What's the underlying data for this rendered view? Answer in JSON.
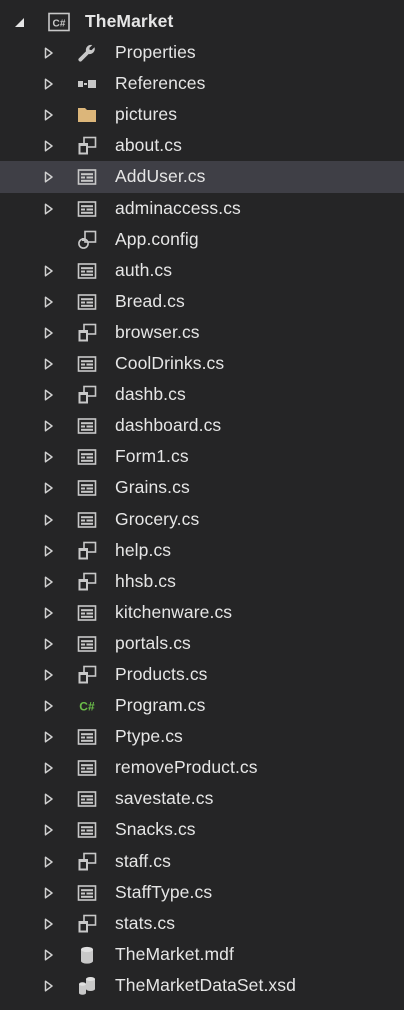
{
  "project": {
    "name": "TheMarket",
    "icon": "csharp-project-icon",
    "expanded": true
  },
  "items": [
    {
      "label": "Properties",
      "icon": "wrench-icon",
      "expandable": true
    },
    {
      "label": "References",
      "icon": "references-icon",
      "expandable": true
    },
    {
      "label": "pictures",
      "icon": "folder-icon",
      "expandable": true
    },
    {
      "label": "about.cs",
      "icon": "form-icon",
      "expandable": true
    },
    {
      "label": "AddUser.cs",
      "icon": "usercontrol-icon",
      "expandable": true,
      "selected": true
    },
    {
      "label": "adminaccess.cs",
      "icon": "usercontrol-icon",
      "expandable": true
    },
    {
      "label": "App.config",
      "icon": "config-icon",
      "expandable": false
    },
    {
      "label": "auth.cs",
      "icon": "usercontrol-icon",
      "expandable": true
    },
    {
      "label": "Bread.cs",
      "icon": "usercontrol-icon",
      "expandable": true
    },
    {
      "label": "browser.cs",
      "icon": "form-icon",
      "expandable": true
    },
    {
      "label": "CoolDrinks.cs",
      "icon": "usercontrol-icon",
      "expandable": true
    },
    {
      "label": "dashb.cs",
      "icon": "form-icon",
      "expandable": true
    },
    {
      "label": "dashboard.cs",
      "icon": "usercontrol-icon",
      "expandable": true
    },
    {
      "label": "Form1.cs",
      "icon": "usercontrol-icon",
      "expandable": true
    },
    {
      "label": "Grains.cs",
      "icon": "usercontrol-icon",
      "expandable": true
    },
    {
      "label": "Grocery.cs",
      "icon": "usercontrol-icon",
      "expandable": true
    },
    {
      "label": "help.cs",
      "icon": "form-icon",
      "expandable": true
    },
    {
      "label": "hhsb.cs",
      "icon": "form-icon",
      "expandable": true
    },
    {
      "label": "kitchenware.cs",
      "icon": "usercontrol-icon",
      "expandable": true
    },
    {
      "label": "portals.cs",
      "icon": "usercontrol-icon",
      "expandable": true
    },
    {
      "label": "Products.cs",
      "icon": "form-icon",
      "expandable": true
    },
    {
      "label": "Program.cs",
      "icon": "csharp-file-icon",
      "expandable": true
    },
    {
      "label": "Ptype.cs",
      "icon": "usercontrol-icon",
      "expandable": true
    },
    {
      "label": "removeProduct.cs",
      "icon": "usercontrol-icon",
      "expandable": true
    },
    {
      "label": "savestate.cs",
      "icon": "usercontrol-icon",
      "expandable": true
    },
    {
      "label": "Snacks.cs",
      "icon": "usercontrol-icon",
      "expandable": true
    },
    {
      "label": "staff.cs",
      "icon": "form-icon",
      "expandable": true
    },
    {
      "label": "StaffType.cs",
      "icon": "usercontrol-icon",
      "expandable": true
    },
    {
      "label": "stats.cs",
      "icon": "form-icon",
      "expandable": true
    },
    {
      "label": "TheMarket.mdf",
      "icon": "database-icon",
      "expandable": true
    },
    {
      "label": "TheMarketDataSet.xsd",
      "icon": "dataset-icon",
      "expandable": true
    }
  ],
  "colors": {
    "background": "#252526",
    "selected_row": "#3f3f46",
    "text": "#e6e6e6",
    "chevron": "#d0d0d0",
    "icon_gray": "#c8c8c8",
    "folder": "#dcb67a",
    "csharp_green": "#6bbd49"
  }
}
